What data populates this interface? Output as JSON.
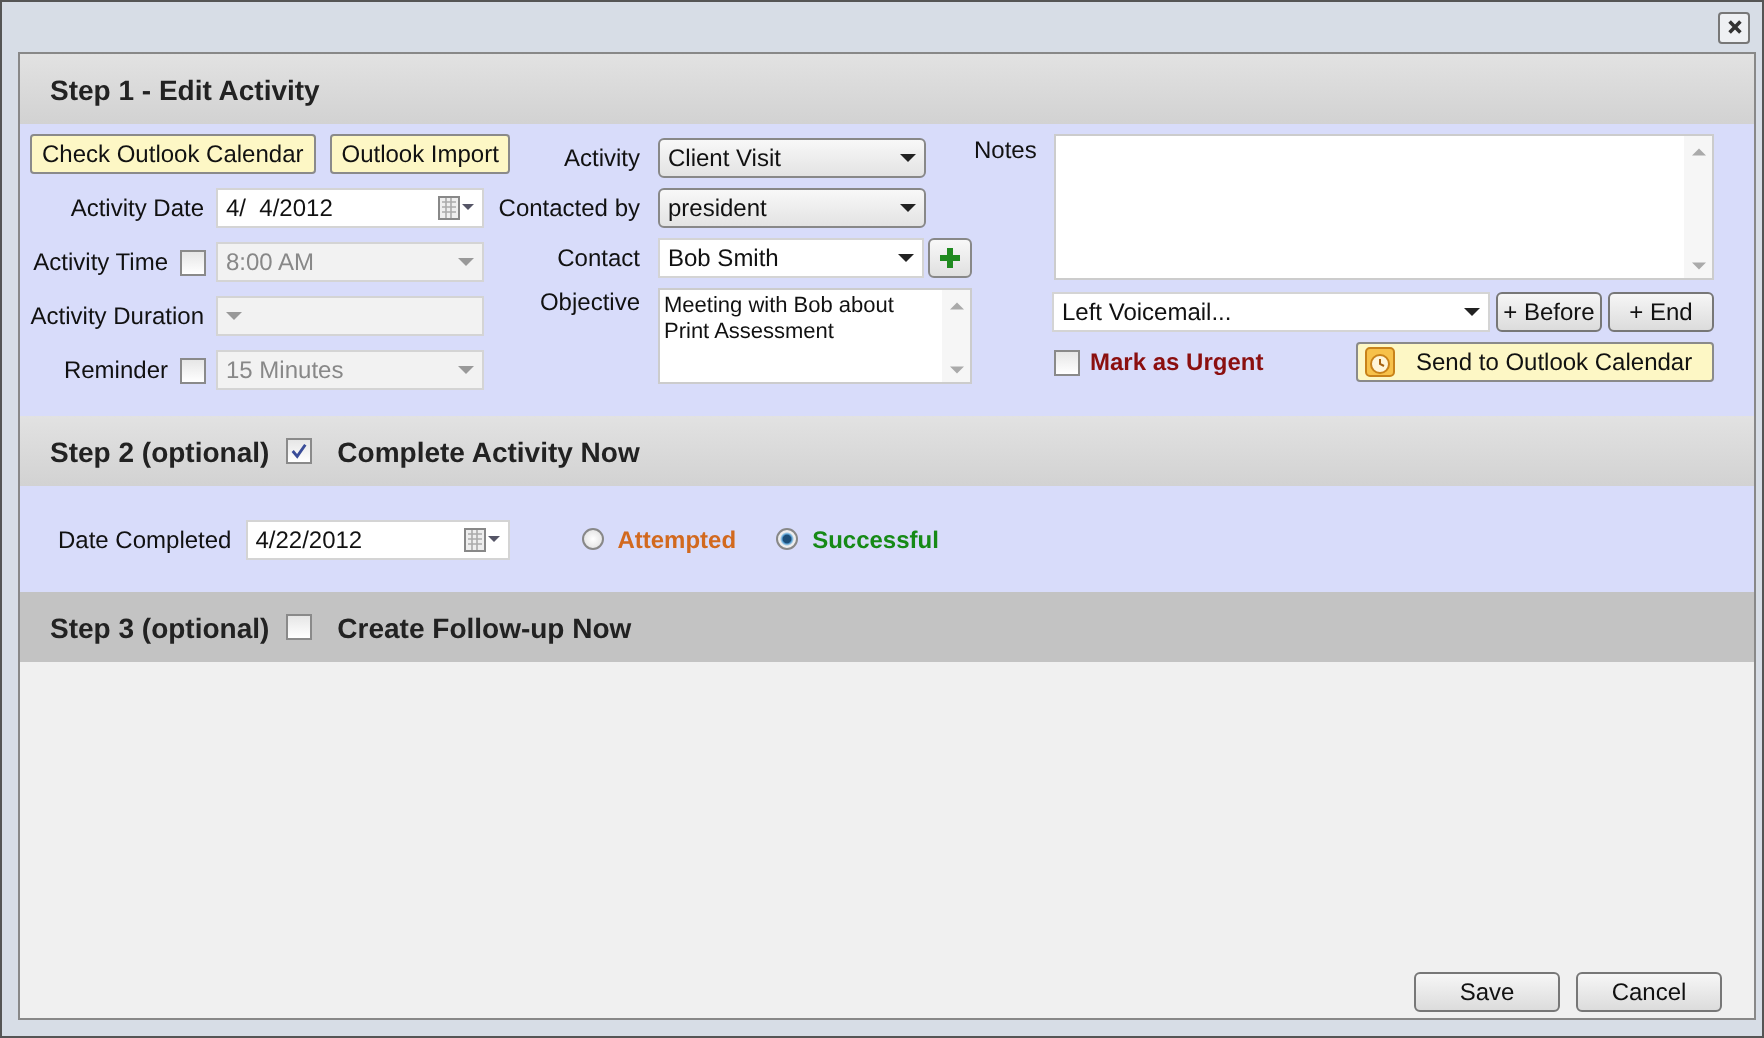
{
  "step1": {
    "title": "Step 1 - Edit Activity",
    "buttons": [
      "Check Outlook Calendar",
      "Outlook Import"
    ],
    "left_fields": [
      {
        "kind": "date",
        "label": "Activity Date",
        "value": "4/  4/2012",
        "disabled": false
      },
      {
        "kind": "combo",
        "label": "Activity Time",
        "toggle": {
          "checked": false
        },
        "value": "8:00 AM",
        "disabled": true
      },
      {
        "kind": "combo",
        "label": "Activity Duration",
        "disabled": true
      },
      {
        "kind": "combo",
        "label": "Reminder",
        "toggle": {
          "checked": false
        },
        "value": "15 Minutes",
        "disabled": true
      }
    ],
    "middle_fields": [
      {
        "kind": "dropdown",
        "label": "Activity",
        "value": "Client Visit"
      },
      {
        "kind": "dropdown",
        "label": "Contacted by",
        "value": "president"
      },
      {
        "kind": "combo-add",
        "label": "Contact",
        "value": "Bob Smith"
      },
      {
        "kind": "memo",
        "label": "Objective",
        "value": "Meeting with Bob about Print Assessment"
      }
    ],
    "notes": {
      "label": "Notes"
    },
    "template": {
      "value": "Left Voicemail...",
      "buttons": [
        "+ Before",
        "+ End"
      ]
    },
    "urgent": {
      "label": "Mark as Urgent",
      "checked": false
    },
    "send_button": "Send to Outlook Calendar"
  },
  "step2": {
    "title": "Step 2 (optional)",
    "toggle_label": "Complete Activity Now",
    "checked": true,
    "date_label": "Date Completed",
    "date_value": "4/22/2012",
    "outcomes": [
      {
        "label": "Attempted",
        "selected": false,
        "color": "#d2691e"
      },
      {
        "label": "Successful",
        "selected": true,
        "color": "#168a16"
      }
    ]
  },
  "step3": {
    "title": "Step 3 (optional)",
    "toggle_label": "Create Follow-up Now",
    "checked": false
  },
  "footer_buttons": [
    "Save",
    "Cancel"
  ]
}
